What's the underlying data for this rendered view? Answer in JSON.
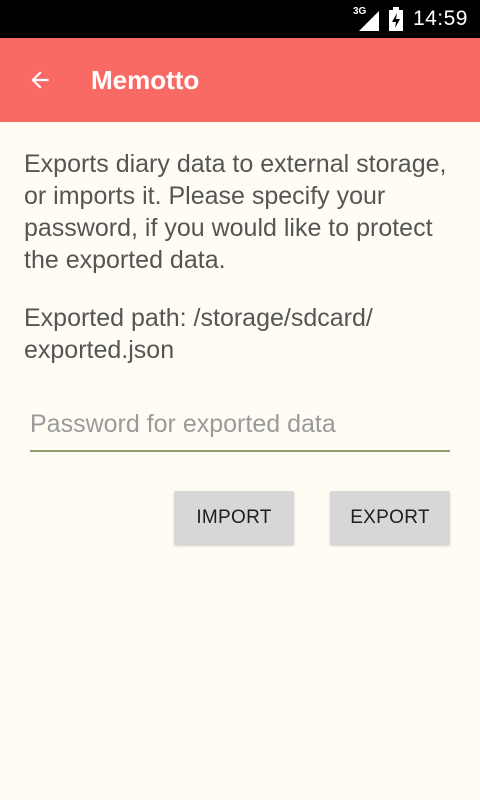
{
  "status_bar": {
    "network_type": "3G",
    "time": "14:59",
    "icons": [
      "signal-icon",
      "battery-icon"
    ]
  },
  "app_bar": {
    "title": "Memotto",
    "background_color": "#F96A65",
    "back_icon": "arrow-back-icon"
  },
  "content": {
    "description": "Exports diary data to external storage, or imports it. Please specify your password, if you would like to protect the exported data.",
    "exported_path": "Exported path: /storage/sdcard/​exported.json",
    "password_placeholder": "Password for exported data",
    "password_value": ""
  },
  "buttons": {
    "import_label": "IMPORT",
    "export_label": "EXPORT"
  },
  "colors": {
    "background": "#FFFDF3",
    "accent_underline": "#8E9E73",
    "button_bg": "#D7D7D7"
  }
}
